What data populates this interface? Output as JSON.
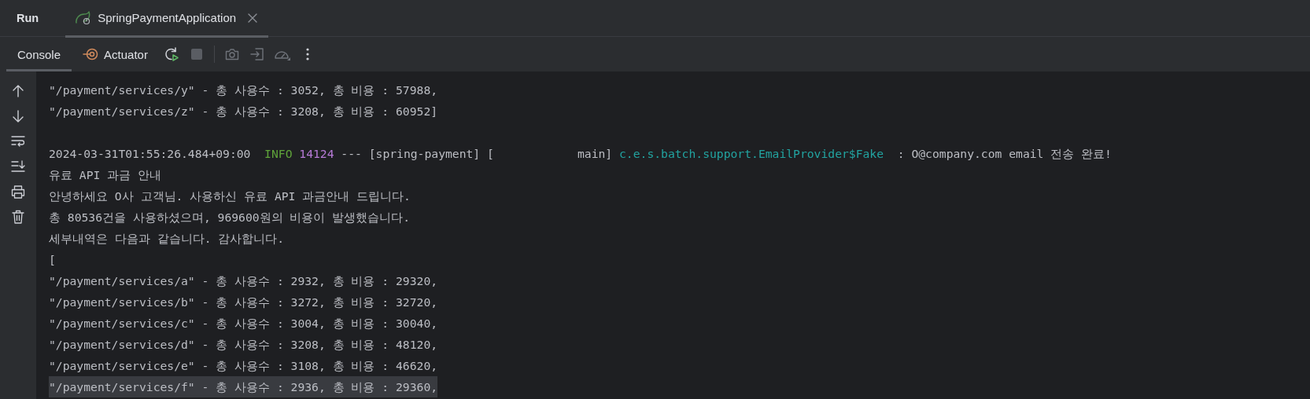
{
  "tool_window": {
    "title": "Run"
  },
  "tabs": [
    {
      "label": "SpringPaymentApplication",
      "selected": true,
      "closable": true
    }
  ],
  "toolbar": {
    "tabs": [
      {
        "label": "Console",
        "selected": true,
        "kind": "console"
      },
      {
        "label": "Actuator",
        "selected": false,
        "kind": "actuator"
      }
    ],
    "actions": [
      {
        "kind": "rerun",
        "disabled": false
      },
      {
        "kind": "stop",
        "disabled": true
      },
      {
        "kind": "camera",
        "disabled": true
      },
      {
        "kind": "exit",
        "disabled": true
      },
      {
        "kind": "gauge",
        "disabled": true
      },
      {
        "kind": "more",
        "disabled": false
      }
    ]
  },
  "gutter": [
    {
      "kind": "up"
    },
    {
      "kind": "down"
    },
    {
      "kind": "wrap"
    },
    {
      "kind": "scroll-end"
    },
    {
      "kind": "print"
    },
    {
      "kind": "trash"
    }
  ],
  "console": {
    "lines": [
      {
        "kind": "plain",
        "text": "\"/payment/services/y\" - 총 사용수 : 3052, 총 비용 : 57988,",
        "highlighted": false
      },
      {
        "kind": "plain",
        "text": "\"/payment/services/z\" - 총 사용수 : 3208, 총 비용 : 60952]",
        "highlighted": false
      },
      {
        "kind": "blank"
      },
      {
        "kind": "log",
        "segments": [
          {
            "kind": "timestamp",
            "text": "2024-03-31T01:55:26.484+09:00",
            "color": "#bcbec4"
          },
          {
            "kind": "level",
            "text": "INFO",
            "color": "#5fa33a"
          },
          {
            "kind": "pid",
            "text": "14124",
            "color": "#b67ad6"
          },
          {
            "kind": "separator",
            "text": "---",
            "color": "#bcbec4"
          },
          {
            "kind": "app",
            "text": "[spring-payment]",
            "color": "#bcbec4"
          },
          {
            "kind": "thread",
            "text": "[            main]",
            "color": "#bcbec4"
          },
          {
            "kind": "logger",
            "text": "c.e.s.batch.support.EmailProvider$Fake",
            "color": "#22a3a0"
          },
          {
            "kind": "message",
            "text": ": O@company.com email 전송 완료!",
            "color": "#bcbec4"
          }
        ]
      },
      {
        "kind": "plain",
        "text": "유료 API 과금 안내",
        "highlighted": false
      },
      {
        "kind": "plain",
        "text": "안녕하세요 O사 고객님. 사용하신 유료 API 과금안내 드립니다.",
        "highlighted": false
      },
      {
        "kind": "plain",
        "text": "총 80536건을 사용하셨으며, 969600원의 비용이 발생했습니다.",
        "highlighted": false
      },
      {
        "kind": "plain",
        "text": "세부내역은 다음과 같습니다. 감사합니다.",
        "highlighted": false
      },
      {
        "kind": "plain",
        "text": "[",
        "highlighted": false
      },
      {
        "kind": "plain",
        "text": "\"/payment/services/a\" - 총 사용수 : 2932, 총 비용 : 29320,",
        "highlighted": false
      },
      {
        "kind": "plain",
        "text": "\"/payment/services/b\" - 총 사용수 : 3272, 총 비용 : 32720,",
        "highlighted": false
      },
      {
        "kind": "plain",
        "text": "\"/payment/services/c\" - 총 사용수 : 3004, 총 비용 : 30040,",
        "highlighted": false
      },
      {
        "kind": "plain",
        "text": "\"/payment/services/d\" - 총 사용수 : 3208, 총 비용 : 48120,",
        "highlighted": false
      },
      {
        "kind": "plain",
        "text": "\"/payment/services/e\" - 총 사용수 : 3108, 총 비용 : 46620,",
        "highlighted": false
      },
      {
        "kind": "plain",
        "text": "\"/payment/services/f\" - 총 사용수 : 2936, 총 비용 : 29360,",
        "highlighted": true
      }
    ]
  }
}
